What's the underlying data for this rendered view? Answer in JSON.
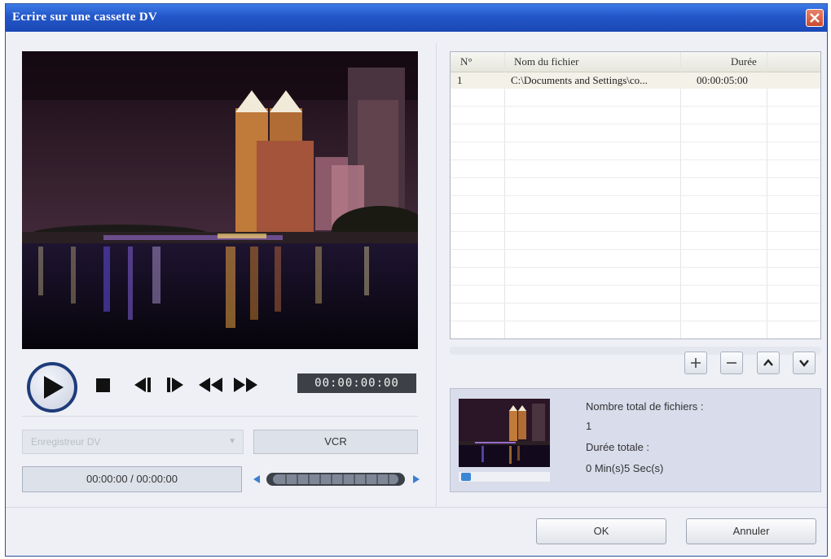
{
  "window": {
    "title": "Ecrire sur une cassette DV"
  },
  "transport": {
    "timecode": "00:00:00:00"
  },
  "device": {
    "selected": "Enregistreur DV"
  },
  "vcr_label": "VCR",
  "position_label": "00:00:00 / 00:00:00",
  "file_list": {
    "columns": {
      "num": "N°",
      "name": "Nom du fichier",
      "duration": "Durée"
    },
    "rows": [
      {
        "num": "1",
        "name": "C:\\Documents and Settings\\co...",
        "duration": "00:00:05:00"
      }
    ]
  },
  "info": {
    "total_files_label": "Nombre total de fichiers :",
    "total_files_value": "1",
    "total_duration_label": "Durée totale :",
    "total_duration_value": "0 Min(s)5 Sec(s)"
  },
  "buttons": {
    "ok": "OK",
    "cancel": "Annuler"
  }
}
